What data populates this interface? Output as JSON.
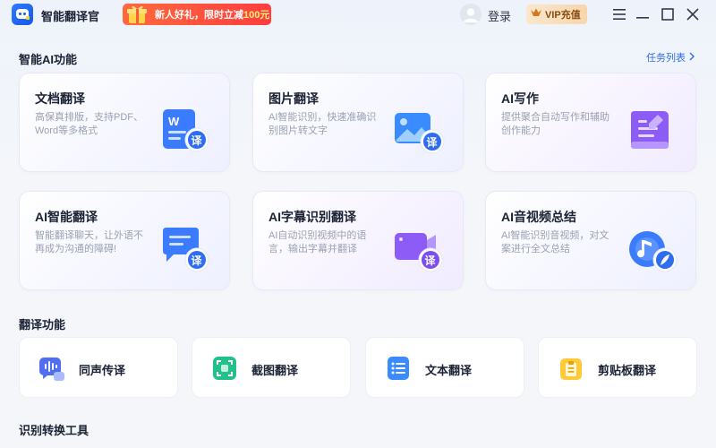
{
  "titlebar": {
    "app_title": "智能翻译官",
    "promo_text_prefix": "新人好礼，限时立减",
    "promo_text_amount": "100元",
    "login_label": "登录",
    "vip_label": "VIP充值"
  },
  "ai_section": {
    "title": "智能AI功能",
    "task_list_label": "任务列表",
    "cards": [
      {
        "title": "文档翻译",
        "desc": "高保真排版，支持PDF、Word等多格式",
        "badge": "译"
      },
      {
        "title": "图片翻译",
        "desc": "AI智能识别，快速准确识别图片转文字",
        "badge": "译"
      },
      {
        "title": "AI写作",
        "desc": "提供聚合自动写作和辅助创作能力",
        "badge": ""
      },
      {
        "title": "AI智能翻译",
        "desc": "智能翻译聊天，让外语不再成为沟通的障碍!",
        "badge": "译"
      },
      {
        "title": "AI字幕识别翻译",
        "desc": "AI自动识别视频中的语言，输出字幕并翻译",
        "badge": "译"
      },
      {
        "title": "AI音视频总结",
        "desc": "AI智能识别音视频，对文案进行全文总结",
        "badge": ""
      }
    ]
  },
  "translate_section": {
    "title": "翻译功能",
    "tools": [
      {
        "label": "同声传译"
      },
      {
        "label": "截图翻译"
      },
      {
        "label": "文本翻译"
      },
      {
        "label": "剪贴板翻译"
      }
    ]
  },
  "convert_section": {
    "title": "识别转换工具"
  },
  "colors": {
    "accent": "#2f6df0",
    "promo": "#ff4a3a",
    "vip_text": "#8a4b12"
  }
}
